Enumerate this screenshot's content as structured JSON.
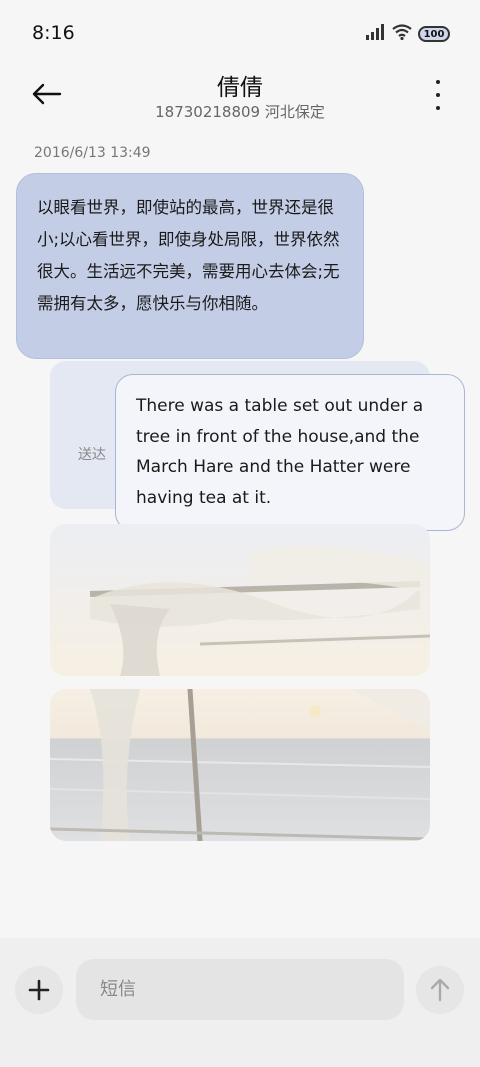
{
  "status_bar": {
    "time": "8:16",
    "battery": "100"
  },
  "header": {
    "contact_name": "倩倩",
    "contact_sub": "18730218809 河北保定"
  },
  "conversation": {
    "timestamp": "2016/6/13 13:49",
    "incoming_text": "以眼看世界，即使站的最高，世界还是很小;以心看世界，即使身处局限，世界依然很大。生活远不完美，需要用心去体会;无需拥有太多，愿快乐与你相随。",
    "delivered_label": "送达",
    "outgoing_text": "There was a table set out under a tree in front of the house,and the March Hare and the Hatter were having tea at it."
  },
  "composer": {
    "placeholder": "短信"
  },
  "colors": {
    "incoming_bubble": "#c3cde5",
    "outgoing_bubble": "#f3f5fb",
    "background": "#f6f6f7"
  },
  "icons": {
    "back": "arrow-left-icon",
    "more": "more-vertical-icon",
    "add": "plus-icon",
    "send": "arrow-up-icon",
    "signal": "signal-icon",
    "wifi": "wifi-icon",
    "battery": "battery-icon"
  }
}
